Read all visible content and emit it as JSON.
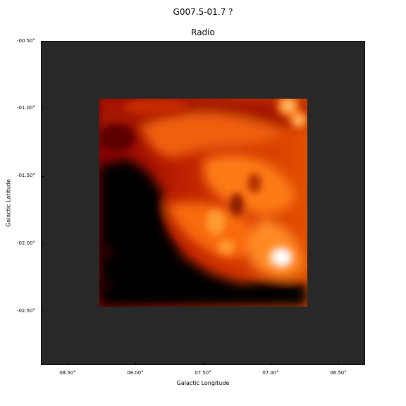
{
  "figure": {
    "suptitle": "G007.5-01.7 ?",
    "panel_title": "Radio"
  },
  "axes": {
    "xlabel": "Galactic Longitude",
    "ylabel": "Galactic Latitude",
    "xticks": [
      "08.50°",
      "08.00°",
      "07.50°",
      "07.00°",
      "06.50°"
    ],
    "yticks": [
      "-00.50°",
      "-01.00°",
      "-01.50°",
      "-02.00°",
      "-02.50°"
    ]
  },
  "colors": {
    "background": "#282828",
    "colormap": "gist_heat"
  },
  "icons": {
    "map": "radio-continuum-map"
  }
}
